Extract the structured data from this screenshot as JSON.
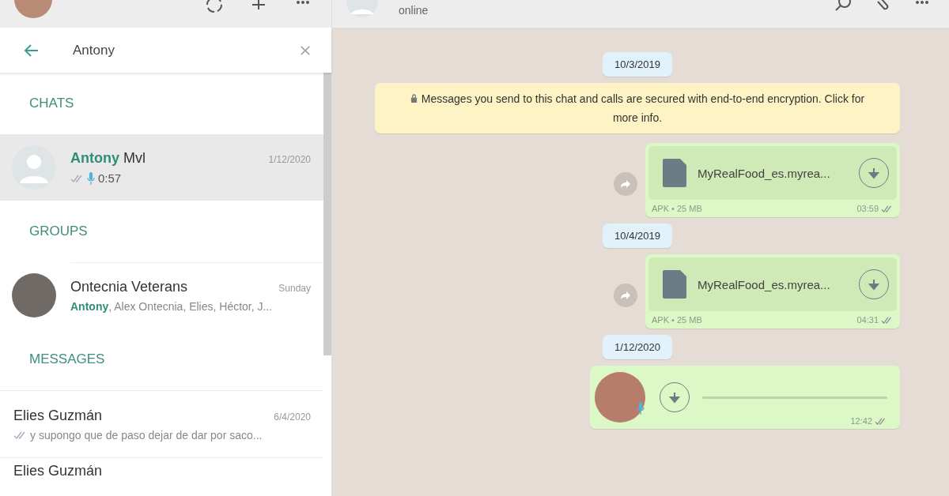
{
  "sidebar": {
    "search": {
      "value": "Antony"
    },
    "sections": [
      {
        "title": "CHATS",
        "items": [
          {
            "kind": "voice",
            "name": "**Antony** Mvl",
            "date": "1/12/2020",
            "preview": "0:57",
            "selected": true
          }
        ]
      },
      {
        "title": "GROUPS",
        "items": [
          {
            "kind": "group",
            "name": "Ontecnia Veterans",
            "date": "Sunday",
            "preview": "**Antony**, Alex Ontecnia, Elies, Héctor, J...",
            "selected": false
          }
        ]
      },
      {
        "title": "MESSAGES",
        "items": [
          {
            "kind": "message",
            "name": "Elies Guzmán",
            "date": "6/4/2020",
            "preview": "y supongo que de paso dejar de dar por saco...",
            "selected": false
          },
          {
            "kind": "cut",
            "name": "Elies Guzmán",
            "selected": false
          }
        ]
      }
    ]
  },
  "chat": {
    "status": "online",
    "messages": [
      {
        "kind": "date",
        "text": "10/3/2019"
      },
      {
        "kind": "system",
        "text": "Messages you send to this chat and calls are secured with end-to-end encryption. Click for more info."
      },
      {
        "kind": "file",
        "filename": "MyRealFood_es.myrea...",
        "meta": "APK • 25 MB",
        "time": "03:59"
      },
      {
        "kind": "date",
        "text": "10/4/2019"
      },
      {
        "kind": "file",
        "filename": "MyRealFood_es.myrea...",
        "meta": "APK • 25 MB",
        "time": "04:31"
      },
      {
        "kind": "date",
        "text": "1/12/2020"
      },
      {
        "kind": "voice",
        "time": "12:42"
      }
    ]
  }
}
